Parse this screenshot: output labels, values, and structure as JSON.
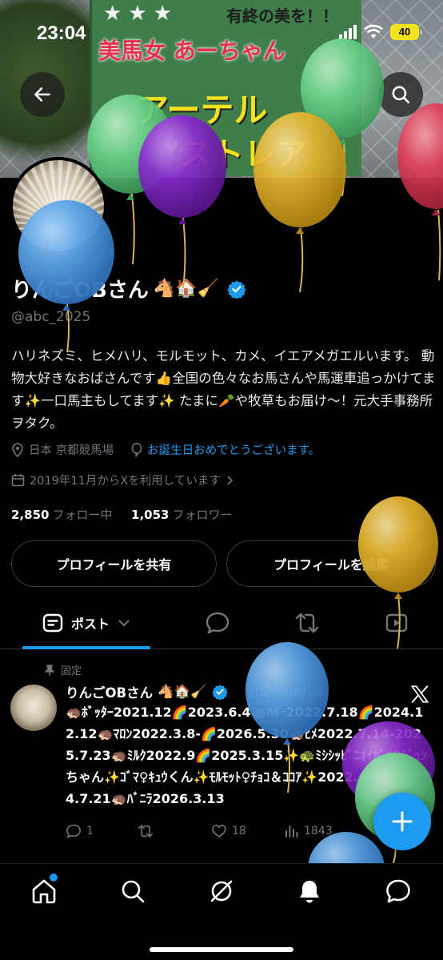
{
  "status_bar": {
    "time": "23:04",
    "battery": "40"
  },
  "banner": {
    "stars": "★★★",
    "top_line": "有終の美を！！",
    "line1": "美馬女 あーちゃん",
    "line2": "アーテル",
    "line3": "アストレア"
  },
  "profile": {
    "name": "りんごOBさん",
    "name_emoji": "🐴🏠🧹",
    "handle": "@abc_2025",
    "bio": "ハリネズミ、ヒメハリ、モルモット、カメ、イエアメガエルいます。 動物大好きなおばさんです👍全国の色々なお馬さんや馬運車追っかけてます✨一口馬主もしてます✨ たまに🥕や牧草もお届け〜！元大手事務所ヲタク。",
    "location": "日本 京都競馬場",
    "birthday_link": "お誕生日おめでとうございます。",
    "joined": "2019年11月からXを利用しています",
    "following_count": "2,850",
    "following_label": "フォロー中",
    "followers_count": "1,053",
    "followers_label": "フォロワー",
    "share_button": "プロフィールを共有",
    "edit_button": "プロフィールを編集"
  },
  "tabs": {
    "posts_label": "ポスト"
  },
  "pinned_post": {
    "pinned_label": "固定",
    "author": "りんごOBさん",
    "author_emoji": "🐴🏠🧹",
    "date": "2026/06/14",
    "text": "🦔ﾎﾞｯﾀｰ2021.12🌈2023.6.4🦔ﾊﾘｰ2022.7.18🌈2024.12.12🦔ﾏﾛﾝ2022.3.8-🌈2026.5.30🦔ﾋﾒ2022.7.14-2025.7.23🦔ﾐﾙｸ2022.9🌈2025.3.15✨🐢ﾐｼｼｯﾋﾟﾆｵｲｶﾞﾒ♀ｼﾞｭﾝちゃん✨ｺﾞﾏ♀ｷｭｳくん✨ﾓﾙﾓｯﾄ♀ﾁｮｺ＆ｺｺｱ✨2022.6.23🦔2024.7.21🦔ﾊﾞﾆﾗ2026.3.13",
    "replies": "1",
    "reposts": "",
    "likes": "18",
    "views": "1843"
  },
  "icons": {
    "back": "arrow-left-icon",
    "search": "search-icon",
    "verified": "verified-badge-icon",
    "location": "location-pin-icon",
    "balloon": "balloon-icon",
    "calendar": "calendar-icon",
    "post_tab": "post-icon",
    "replies_tab": "reply-icon",
    "reposts_tab": "repost-icon",
    "media_tab": "media-icon",
    "pin": "pin-icon",
    "compose": "plus-icon",
    "home": "home-icon",
    "grok": "grok-icon",
    "notifications": "bell-icon",
    "messages": "message-icon"
  },
  "colors": {
    "accent": "#1d9bf0",
    "background": "#000000",
    "secondary_text": "#71767b",
    "battery": "#f3e21e",
    "balloon_colors": [
      "#5aa3e6",
      "#6fd68f",
      "#8a2bd1",
      "#e5b531",
      "#e0405a"
    ]
  }
}
